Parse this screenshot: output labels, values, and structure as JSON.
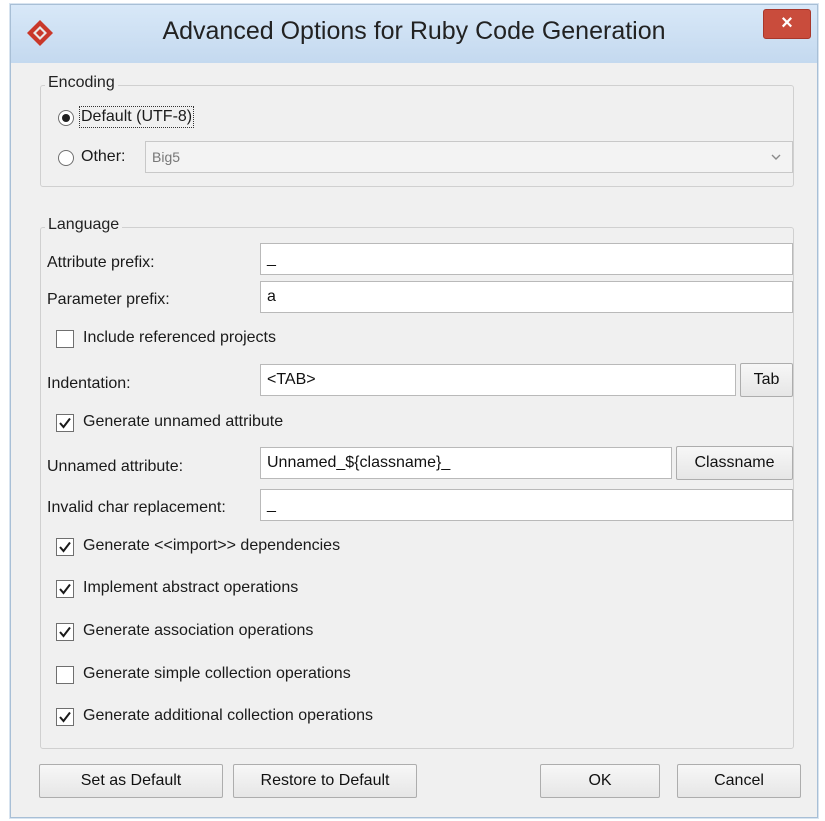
{
  "window": {
    "title": "Advanced Options for Ruby Code Generation",
    "close_label": "×",
    "accent": "#c94c3c"
  },
  "encoding": {
    "group_label": "Encoding",
    "default_label": "Default (UTF-8)",
    "default_selected": true,
    "other_label": "Other:",
    "other_selected": false,
    "other_value": "Big5"
  },
  "language": {
    "group_label": "Language",
    "attribute_prefix_label": "Attribute prefix:",
    "attribute_prefix_value": "_",
    "parameter_prefix_label": "Parameter prefix:",
    "parameter_prefix_value": "a",
    "include_referenced_label": "Include referenced projects",
    "include_referenced_checked": false,
    "indentation_label": "Indentation:",
    "indentation_value": "<TAB>",
    "tab_button": "Tab",
    "generate_unnamed_label": "Generate unnamed attribute",
    "generate_unnamed_checked": true,
    "unnamed_attribute_label": "Unnamed attribute:",
    "unnamed_attribute_value": "Unnamed_${classname}_",
    "classname_button": "Classname",
    "invalid_char_label": "Invalid char replacement:",
    "invalid_char_value": "_",
    "options": [
      {
        "label": "Generate <<import>> dependencies",
        "checked": true
      },
      {
        "label": "Implement abstract operations",
        "checked": true
      },
      {
        "label": "Generate association operations",
        "checked": true
      },
      {
        "label": "Generate simple collection operations",
        "checked": false
      },
      {
        "label": "Generate additional collection operations",
        "checked": true
      }
    ]
  },
  "footer": {
    "set_default": "Set as Default",
    "restore_default": "Restore to Default",
    "ok": "OK",
    "cancel": "Cancel"
  }
}
